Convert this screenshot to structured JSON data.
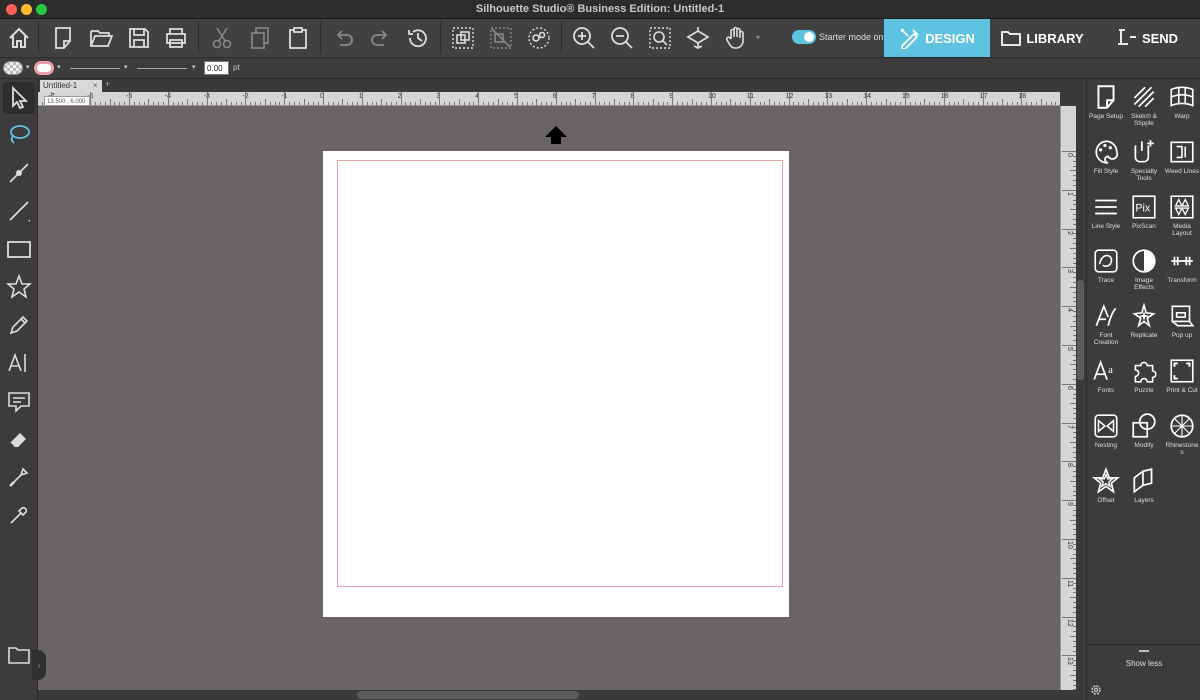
{
  "window": {
    "title": "Silhouette Studio® Business Edition: Untitled-1"
  },
  "toolbar": {
    "starter_mode_label": "Starter mode on",
    "starter_mode_on": true,
    "tabs": {
      "design": "DESIGN",
      "library": "LIBRARY",
      "send": "SEND"
    },
    "accent_color": "#5ec3e0"
  },
  "propbar": {
    "line_width": "0.00",
    "unit": "pt"
  },
  "document": {
    "tab_name": "Untitled-1",
    "tab_close": "×",
    "tab_add": "+",
    "coords_readout": "13.500 , 6.000"
  },
  "ruler": {
    "horizontal_labels": [
      "-8",
      "-7",
      "-6",
      "-5",
      "-4",
      "-3",
      "-2",
      "-1",
      "0",
      "1",
      "2",
      "3",
      "4",
      "5",
      "6",
      "7",
      "8",
      "9",
      "10",
      "11",
      "12",
      "13",
      "14",
      "15",
      "16",
      "17",
      "18"
    ],
    "vertical_labels": [
      "0",
      "1",
      "2",
      "3",
      "4",
      "5",
      "6",
      "7",
      "8",
      "9",
      "10",
      "11",
      "12",
      "13"
    ]
  },
  "panel": {
    "items": [
      {
        "label": "Page Setup",
        "icon": "page-setup-icon"
      },
      {
        "label": "Sketch &\nStipple",
        "icon": "sketch-stipple-icon"
      },
      {
        "label": "Warp",
        "icon": "warp-icon"
      },
      {
        "label": "Fill Style",
        "icon": "fill-style-icon"
      },
      {
        "label": "Specialty\nTools",
        "icon": "specialty-tools-icon"
      },
      {
        "label": "Weed Lines",
        "icon": "weed-lines-icon"
      },
      {
        "label": "Line Style",
        "icon": "line-style-icon"
      },
      {
        "label": "PixScan",
        "icon": "pixscan-icon"
      },
      {
        "label": "Media\nLayout",
        "icon": "media-layout-icon"
      },
      {
        "label": "Trace",
        "icon": "trace-icon"
      },
      {
        "label": "Image\nEffects",
        "icon": "image-effects-icon"
      },
      {
        "label": "Transform",
        "icon": "transform-icon"
      },
      {
        "label": "Font\nCreation",
        "icon": "font-creation-icon"
      },
      {
        "label": "Replicate",
        "icon": "replicate-icon"
      },
      {
        "label": "Pop up",
        "icon": "pop-up-icon"
      },
      {
        "label": "Fonts",
        "icon": "fonts-icon"
      },
      {
        "label": "Puzzle",
        "icon": "puzzle-icon"
      },
      {
        "label": "Print & Cut",
        "icon": "print-cut-icon"
      },
      {
        "label": "Nesting",
        "icon": "nesting-icon"
      },
      {
        "label": "Modify",
        "icon": "modify-icon"
      },
      {
        "label": "Rhinestone\ns",
        "icon": "rhinestones-icon"
      },
      {
        "label": "Offset",
        "icon": "offset-icon"
      },
      {
        "label": "Layers",
        "icon": "layers-icon"
      }
    ],
    "show_less": "Show less"
  }
}
